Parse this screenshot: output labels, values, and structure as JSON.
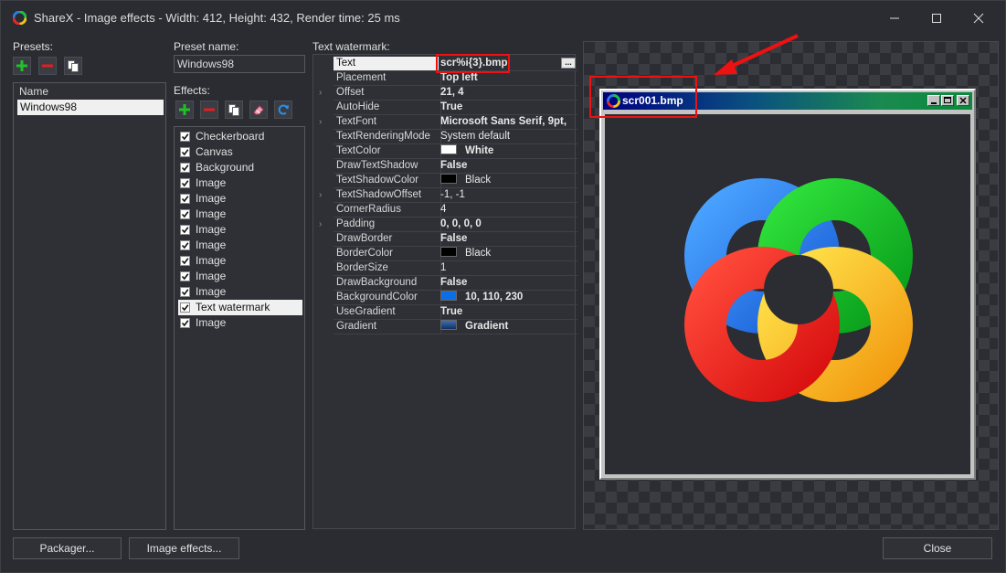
{
  "window": {
    "title": "ShareX - Image effects - Width: 412, Height: 432, Render time: 25 ms"
  },
  "presets": {
    "label": "Presets:",
    "column_header": "Name",
    "items": [
      "Windows98"
    ]
  },
  "preset_name": {
    "label": "Preset name:",
    "value": "Windows98"
  },
  "effects": {
    "label": "Effects:",
    "items": [
      {
        "label": "Checkerboard",
        "checked": true
      },
      {
        "label": "Canvas",
        "checked": true
      },
      {
        "label": "Background",
        "checked": true
      },
      {
        "label": "Image",
        "checked": true
      },
      {
        "label": "Image",
        "checked": true
      },
      {
        "label": "Image",
        "checked": true
      },
      {
        "label": "Image",
        "checked": true
      },
      {
        "label": "Image",
        "checked": true
      },
      {
        "label": "Image",
        "checked": true
      },
      {
        "label": "Image",
        "checked": true
      },
      {
        "label": "Image",
        "checked": true
      },
      {
        "label": "Text watermark",
        "checked": true,
        "selected": true
      },
      {
        "label": "Image",
        "checked": true
      }
    ]
  },
  "properties": {
    "label": "Text watermark:",
    "rows": [
      {
        "name": "Text",
        "value": "scr%i{3}.bmp",
        "bold": true,
        "selected": true
      },
      {
        "name": "Placement",
        "value": "Top left",
        "bold": true
      },
      {
        "name": "Offset",
        "value": "21, 4",
        "bold": true,
        "expandable": true
      },
      {
        "name": "AutoHide",
        "value": "True",
        "bold": true
      },
      {
        "name": "TextFont",
        "value": "Microsoft Sans Serif, 9pt,",
        "bold": true,
        "expandable": true
      },
      {
        "name": "TextRenderingMode",
        "value": "System default",
        "bold": false
      },
      {
        "name": "TextColor",
        "value": "White",
        "bold": true,
        "swatch": "#ffffff"
      },
      {
        "name": "DrawTextShadow",
        "value": "False",
        "bold": true
      },
      {
        "name": "TextShadowColor",
        "value": "Black",
        "bold": false,
        "swatch": "#000000"
      },
      {
        "name": "TextShadowOffset",
        "value": "-1, -1",
        "bold": false,
        "expandable": true
      },
      {
        "name": "CornerRadius",
        "value": "4",
        "bold": false
      },
      {
        "name": "Padding",
        "value": "0, 0, 0, 0",
        "bold": true,
        "expandable": true
      },
      {
        "name": "DrawBorder",
        "value": "False",
        "bold": true
      },
      {
        "name": "BorderColor",
        "value": "Black",
        "bold": false,
        "swatch": "#000000"
      },
      {
        "name": "BorderSize",
        "value": "1",
        "bold": false
      },
      {
        "name": "DrawBackground",
        "value": "False",
        "bold": true
      },
      {
        "name": "BackgroundColor",
        "value": "10, 110, 230",
        "bold": true,
        "swatch": "#0a6ee6"
      },
      {
        "name": "UseGradient",
        "value": "True",
        "bold": true
      },
      {
        "name": "Gradient",
        "value": "Gradient",
        "bold": true,
        "swatch": "#1e4a8a"
      }
    ]
  },
  "preview": {
    "window_title": "scr001.bmp"
  },
  "buttons": {
    "packager": "Packager...",
    "image_effects": "Image effects...",
    "close": "Close"
  },
  "colors": {
    "accent_add": "#22c02a",
    "accent_remove": "#e02020",
    "highlight": "#ee1111"
  }
}
